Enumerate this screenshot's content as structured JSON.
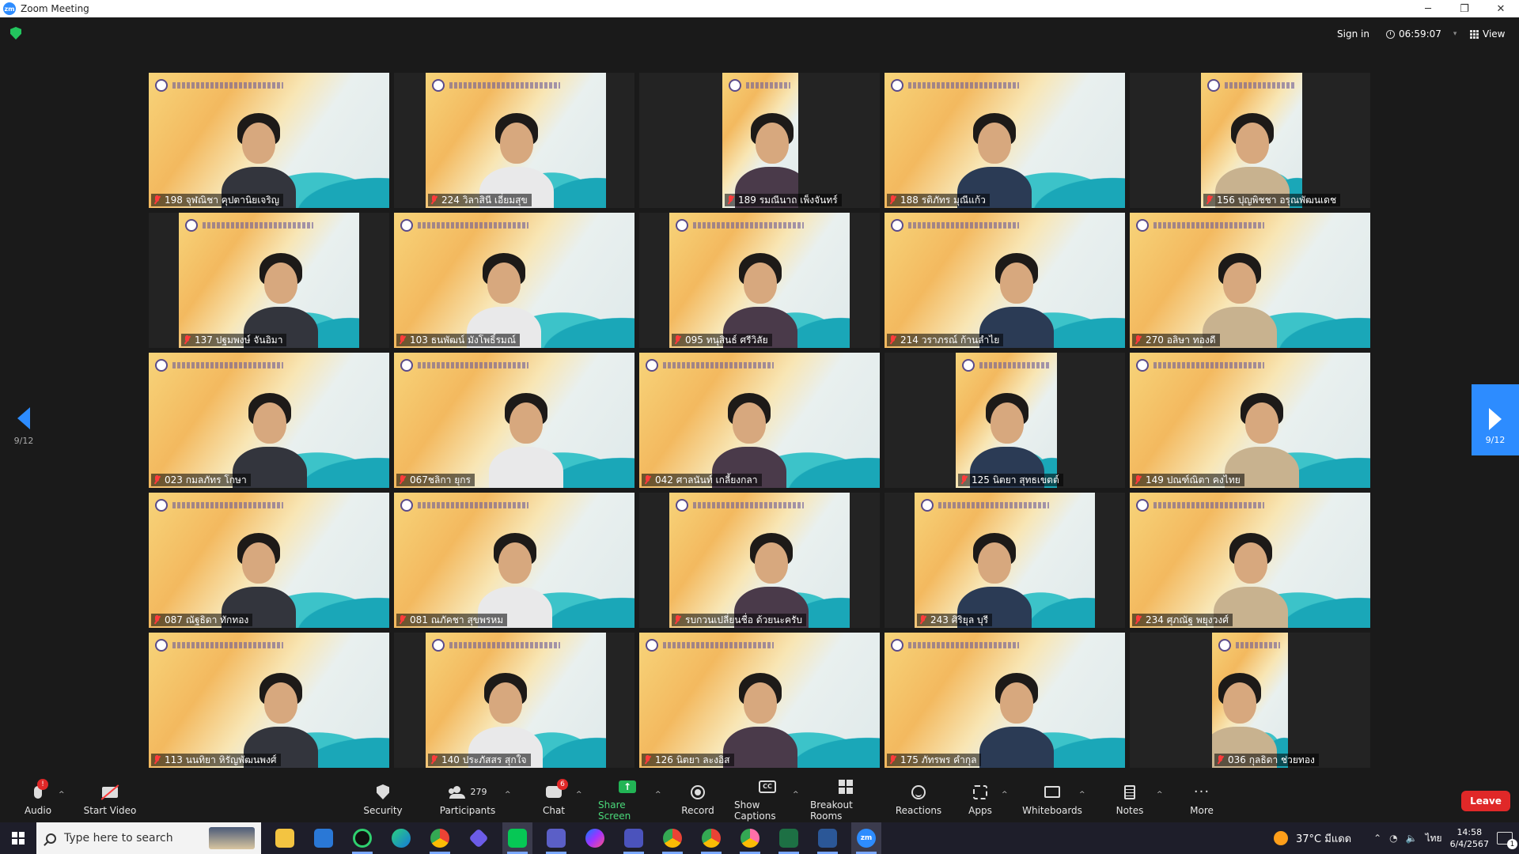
{
  "window": {
    "title": "Zoom Meeting",
    "minimize": "─",
    "restore": "❐",
    "close": "✕"
  },
  "topbar": {
    "signin": "Sign in",
    "timer": "06:59:07",
    "view": "View"
  },
  "pager": {
    "left_label": "9/12",
    "right_label": "9/12"
  },
  "participants": [
    {
      "name": "198 จุฬณิชา คุปตานิยเจริญ"
    },
    {
      "name": "224 วิลาสินี เอี่ยมสุข"
    },
    {
      "name": "189 รมณีนาถ เพ็งจันทร์"
    },
    {
      "name": "188 รติภัทร มุณีแก้ว"
    },
    {
      "name": "156 ปุญพิชชา อรุณพัฒนเดช"
    },
    {
      "name": "137 ปฐมพงษ์ จันอิมา"
    },
    {
      "name": "103 ธนพัฒน์ มังโพธิ์รมณ์"
    },
    {
      "name": "095 ทนุสินธ์ ศรีวิลัย"
    },
    {
      "name": "214 วราภรณ์ ก้านลำไย"
    },
    {
      "name": "270 อลิษา ทองดี"
    },
    {
      "name": "023 กมลภัทร โกษา"
    },
    {
      "name": "067ชลิกา ยุกร"
    },
    {
      "name": "042 ศาลนันท์ เกลี้ยงกลา"
    },
    {
      "name": "125 นิตยา สุทธเขตต์"
    },
    {
      "name": "149 ปณฑ์ณิตา คงไทย"
    },
    {
      "name": "087 ณัฐธิดา ทักทอง"
    },
    {
      "name": "081 ณภัคชา สุขพรหม"
    },
    {
      "name": "รบกวนเปลี่ยนชื่อ ด้วยนะครับ"
    },
    {
      "name": "243 ศิริยุล บุรี"
    },
    {
      "name": "234 ศุภณัฐ พยุงวงศ์"
    },
    {
      "name": "113 นนทิยา หิรัญพัฒนพงศ์"
    },
    {
      "name": "140 ประภัสสร สุกใจ"
    },
    {
      "name": "126 นิตยา ละงอิส"
    },
    {
      "name": "175 ภัทรพร คำกุล"
    },
    {
      "name": "036 กุลธิดา ช่วยทอง"
    }
  ],
  "toolbar": {
    "audio": "Audio",
    "audio_badge": "!",
    "start_video": "Start Video",
    "security": "Security",
    "participants": "Participants",
    "participants_count": "279",
    "chat": "Chat",
    "chat_badge": "6",
    "share_screen": "Share Screen",
    "record": "Record",
    "show_captions": "Show Captions",
    "cc": "CC",
    "breakout_rooms": "Breakout Rooms",
    "reactions": "Reactions",
    "apps": "Apps",
    "whiteboards": "Whiteboards",
    "notes": "Notes",
    "more": "More",
    "more_glyph": "···",
    "leave": "Leave"
  },
  "taskbar": {
    "search_placeholder": "Type here to search",
    "weather": "37°C มีแดด",
    "language": "ไทย",
    "time": "14:58",
    "date": "6/4/2567",
    "notif_count": "1",
    "zoom_label": "zm"
  }
}
